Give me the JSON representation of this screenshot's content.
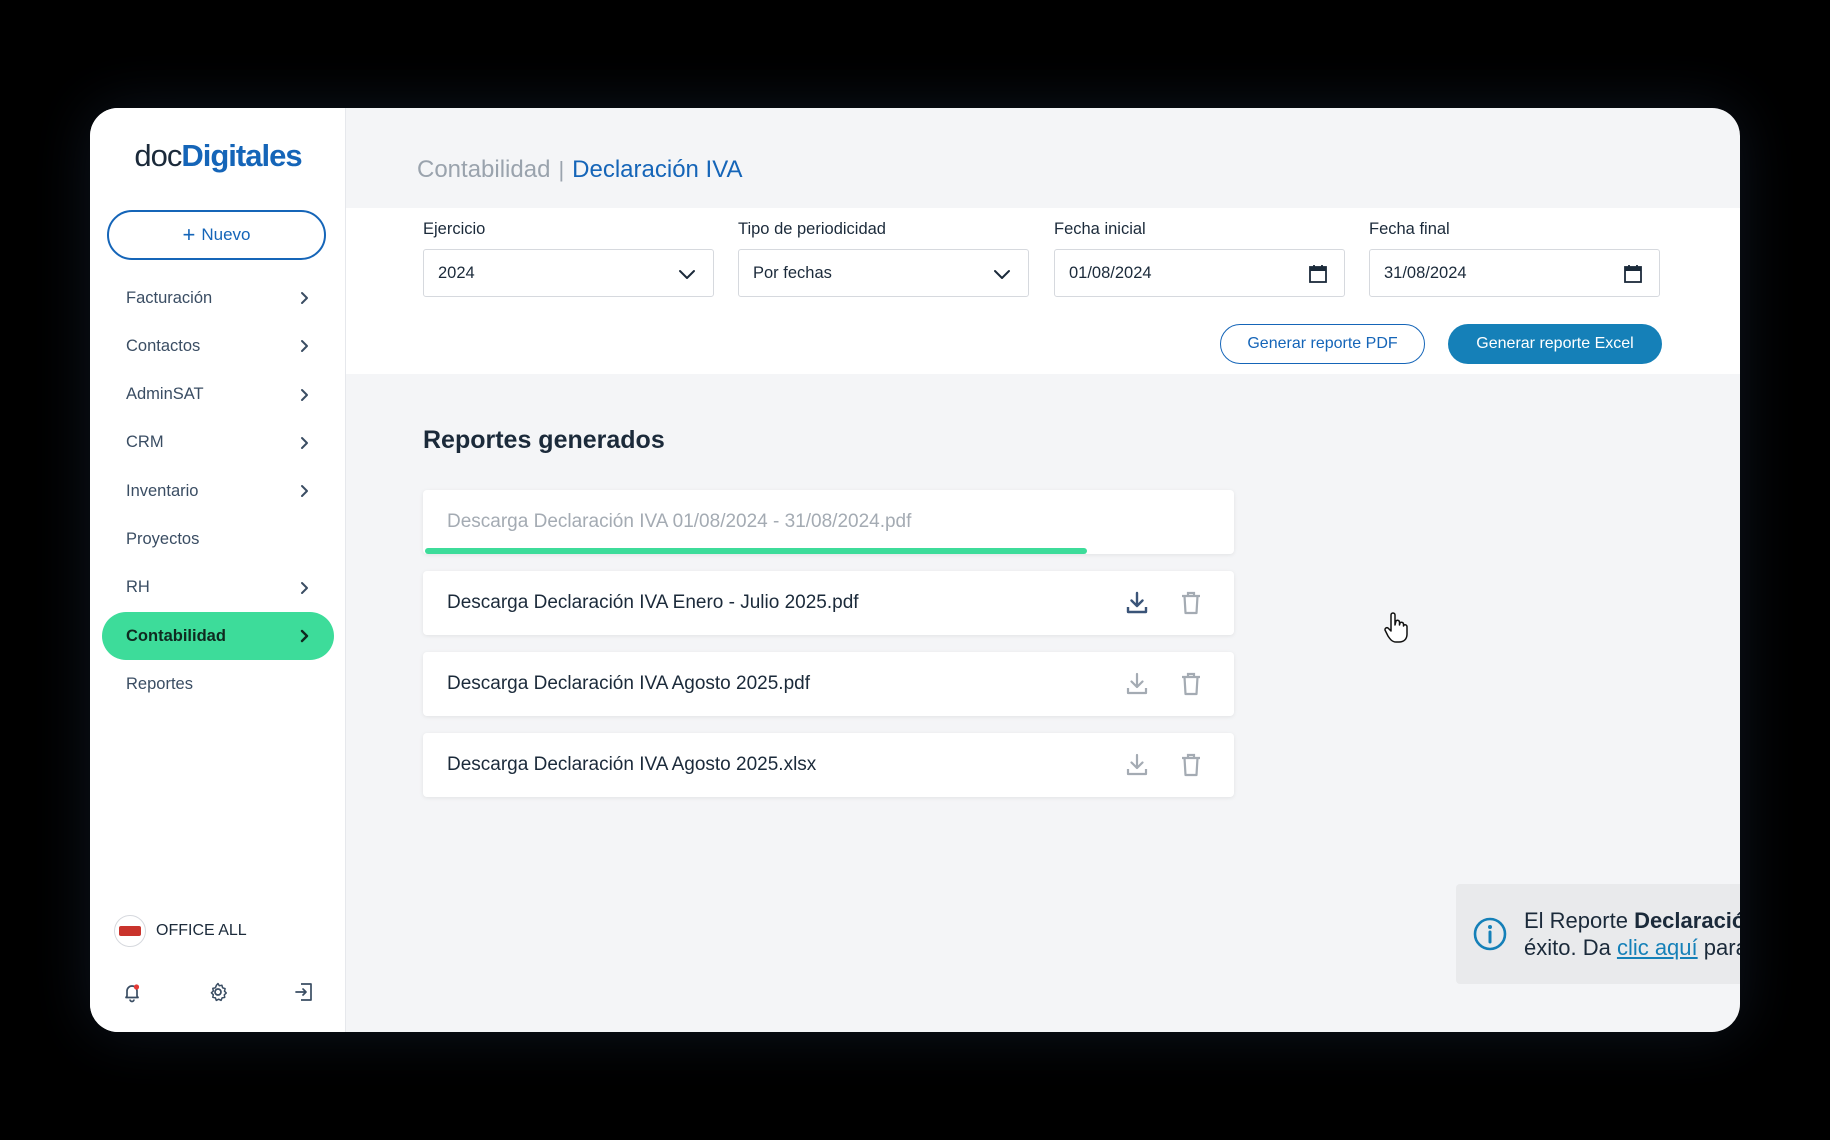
{
  "brand": {
    "logo_part1": "doc",
    "logo_part2": "Digitales",
    "primary_color": "#1565b8",
    "accent_color": "#3ddc9a"
  },
  "sidebar": {
    "new_button": {
      "icon": "plus-icon",
      "label": "Nuevo"
    },
    "items": [
      {
        "label": "Facturación",
        "has_submenu": true
      },
      {
        "label": "Contactos",
        "has_submenu": true
      },
      {
        "label": "AdminSAT",
        "has_submenu": true
      },
      {
        "label": "CRM",
        "has_submenu": true
      },
      {
        "label": "Inventario",
        "has_submenu": true
      },
      {
        "label": "Proyectos",
        "has_submenu": false
      },
      {
        "label": "RH",
        "has_submenu": true
      },
      {
        "label": "Contabilidad",
        "has_submenu": true,
        "active": true
      },
      {
        "label": "Reportes",
        "has_submenu": false
      }
    ],
    "organization": {
      "name": "OFFICE ALL"
    },
    "bottom_icons": [
      "bell-icon",
      "gear-icon",
      "logout-icon"
    ]
  },
  "breadcrumb": {
    "parent": "Contabilidad",
    "separator": "|",
    "current": "Declaración IVA"
  },
  "filters": {
    "ejercicio": {
      "label": "Ejercicio",
      "value": "2024"
    },
    "periodicidad": {
      "label": "Tipo de periodicidad",
      "value": "Por fechas"
    },
    "fecha_inicial": {
      "label": "Fecha inicial",
      "value": "01/08/2024"
    },
    "fecha_final": {
      "label": "Fecha final",
      "value": "31/08/2024"
    }
  },
  "actions": {
    "pdf": "Generar reporte PDF",
    "excel": "Generar reporte Excel"
  },
  "reports": {
    "title": "Reportes generados",
    "items": [
      {
        "name": "Descarga Declaración IVA 01/08/2024 - 31/08/2024.pdf",
        "status": "generating",
        "progress": 0.82
      },
      {
        "name": "Descarga Declaración IVA Enero - Julio 2025.pdf",
        "status": "ready"
      },
      {
        "name": "Descarga Declaración IVA Agosto 2025.pdf",
        "status": "ready"
      },
      {
        "name": "Descarga Declaración IVA Agosto 2025.xlsx",
        "status": "ready"
      }
    ]
  },
  "toast": {
    "prefix": "El Reporte ",
    "report_name": "Declaración IVA",
    "middle": " se generó con éxito. Da ",
    "link": "clic aquí",
    "suffix": " para consultarlo."
  }
}
